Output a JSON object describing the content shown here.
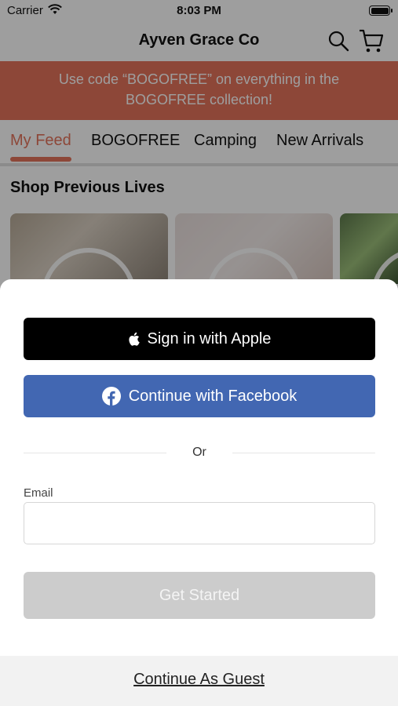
{
  "status_bar": {
    "carrier": "Carrier",
    "time": "8:03 PM"
  },
  "header": {
    "title": "Ayven Grace Co",
    "icons": [
      "search-icon",
      "cart-icon"
    ]
  },
  "promo": {
    "text": "Use code “BOGOFREE” on everything in the BOGOFREE collection!",
    "color": "#e4735b"
  },
  "tabs": [
    {
      "label": "My Feed",
      "active": true
    },
    {
      "label": "BOGOFREE",
      "active": false
    },
    {
      "label": "Camping",
      "active": false
    },
    {
      "label": "New Arrivals",
      "active": false
    }
  ],
  "section": {
    "title": "Shop Previous Lives"
  },
  "sheet": {
    "apple_label": "Sign in with Apple",
    "facebook_label": "Continue with Facebook",
    "or_text": "Or",
    "email_label": "Email",
    "email_value": "",
    "email_placeholder": "",
    "get_started_label": "Get Started",
    "guest_label": "Continue As Guest",
    "facebook_color": "#4267b2"
  }
}
